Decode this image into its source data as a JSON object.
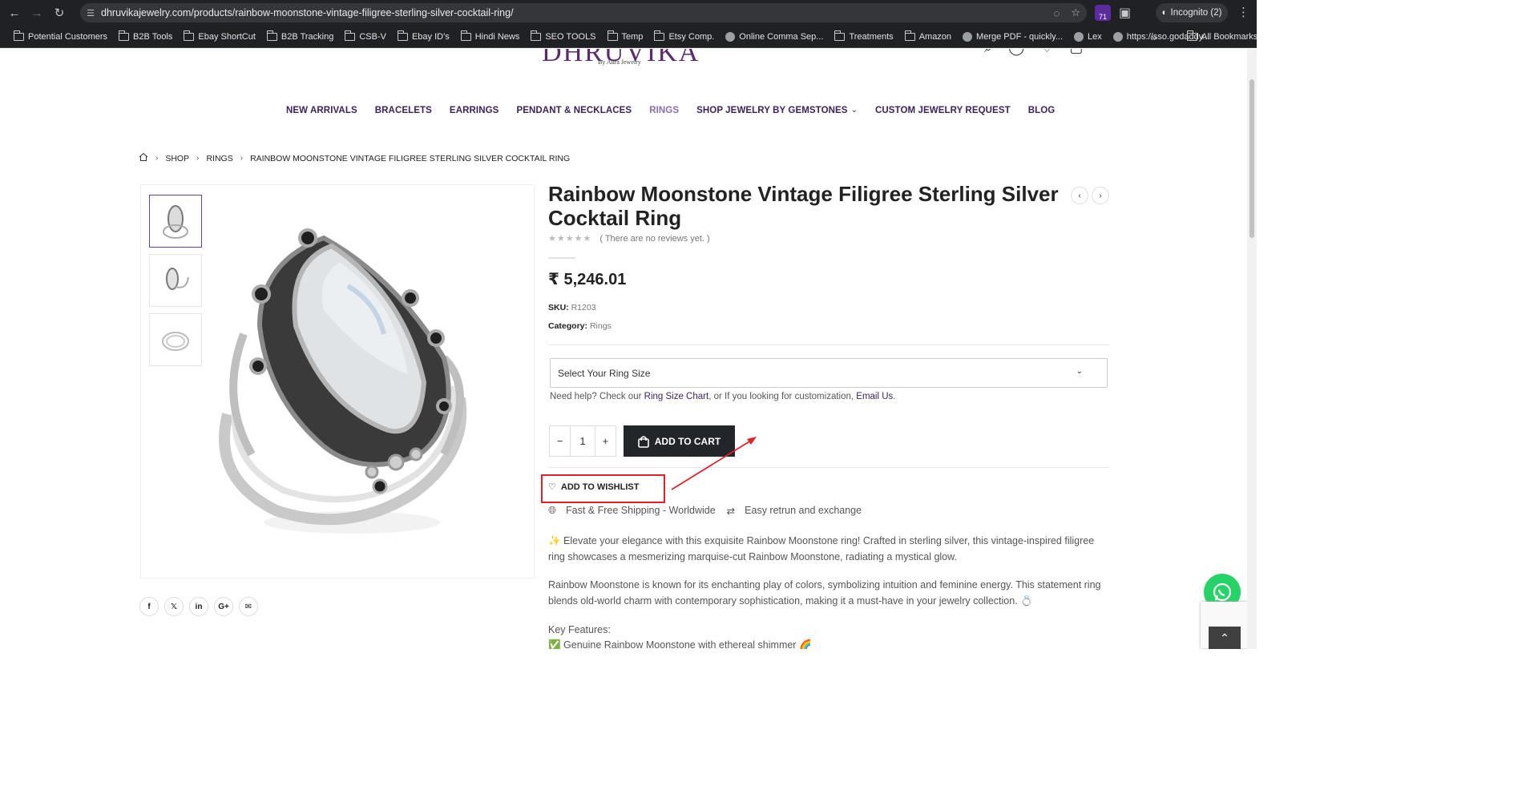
{
  "browser": {
    "url": "dhruvikajewelry.com/products/rainbow-moonstone-vintage-filigree-sterling-silver-cocktail-ring/",
    "incognito_label": "Incognito (2)",
    "extension_badge": "71",
    "bookmarks": [
      {
        "label": "Potential Customers",
        "icon": "folder-icon"
      },
      {
        "label": "B2B Tools",
        "icon": "folder-icon"
      },
      {
        "label": "Ebay ShortCut",
        "icon": "folder-icon"
      },
      {
        "label": "B2B Tracking",
        "icon": "folder-icon"
      },
      {
        "label": "CSB-V",
        "icon": "folder-icon"
      },
      {
        "label": "Ebay ID's",
        "icon": "folder-icon"
      },
      {
        "label": "Hindi News",
        "icon": "folder-icon"
      },
      {
        "label": "SEO TOOLS",
        "icon": "folder-icon"
      },
      {
        "label": "Temp",
        "icon": "folder-icon"
      },
      {
        "label": "Etsy Comp.",
        "icon": "folder-icon"
      },
      {
        "label": "Online Comma Sep...",
        "icon": "page-icon"
      },
      {
        "label": "Treatments",
        "icon": "folder-icon"
      },
      {
        "label": "Amazon",
        "icon": "folder-icon"
      },
      {
        "label": "Merge PDF - quickly...",
        "icon": "pdf-icon"
      },
      {
        "label": "Lex",
        "icon": "globe-icon"
      },
      {
        "label": "https://sso.godaddy...",
        "icon": "godaddy-icon"
      }
    ],
    "all_bookmarks": "All Bookmarks"
  },
  "site": {
    "logo": "DHRUVIKA",
    "logo_sub": "By Aura Jewelry",
    "nav": [
      "NEW ARRIVALS",
      "BRACELETS",
      "EARRINGS",
      "PENDANT & NECKLACES",
      "RINGS",
      "SHOP JEWELRY BY GEMSTONES",
      "CUSTOM JEWELRY REQUEST",
      "BLOG"
    ],
    "nav_active": "RINGS"
  },
  "breadcrumb": [
    "SHOP",
    "RINGS",
    "RAINBOW MOONSTONE VINTAGE FILIGREE STERLING SILVER COCKTAIL RING"
  ],
  "product": {
    "title": "Rainbow Moonstone Vintage Filigree Sterling Silver Cocktail Ring",
    "reviews": "( There are no reviews yet. )",
    "price": "₹ 5,246.01",
    "sku_label": "SKU:",
    "sku": "R1203",
    "category_label": "Category:",
    "category": "Rings",
    "ring_size_placeholder": "Select Your Ring Size",
    "help_prefix": "Need help? Check our",
    "help_link1": "Ring Size Chart",
    "help_middle": ", or If you looking for customization,",
    "help_link2": "Email Us",
    "help_suffix": ".",
    "quantity": "1",
    "add_to_cart": "ADD TO CART",
    "add_to_wishlist": "ADD TO WISHLIST",
    "shipping": "Fast & Free Shipping - Worldwide",
    "returns": "Easy retrun and exchange",
    "desc1": "✨ Elevate your elegance with this exquisite Rainbow Moonstone ring! Crafted in sterling silver, this vintage-inspired filigree ring showcases a mesmerizing marquise-cut Rainbow Moonstone, radiating a mystical glow.",
    "desc2": "Rainbow Moonstone is known for its enchanting play of colors, symbolizing intuition and feminine energy. This statement ring blends old-world charm with contemporary sophistication, making it a must-have in your jewelry collection. 💍",
    "features_heading": "Key Features:",
    "feature1": "✅ Genuine Rainbow Moonstone with ethereal shimmer 🌈"
  },
  "colors": {
    "brand": "#3b1f5c",
    "annotation": "#e5202a",
    "cart_button": "#222529",
    "whatsapp": "#25d366"
  }
}
